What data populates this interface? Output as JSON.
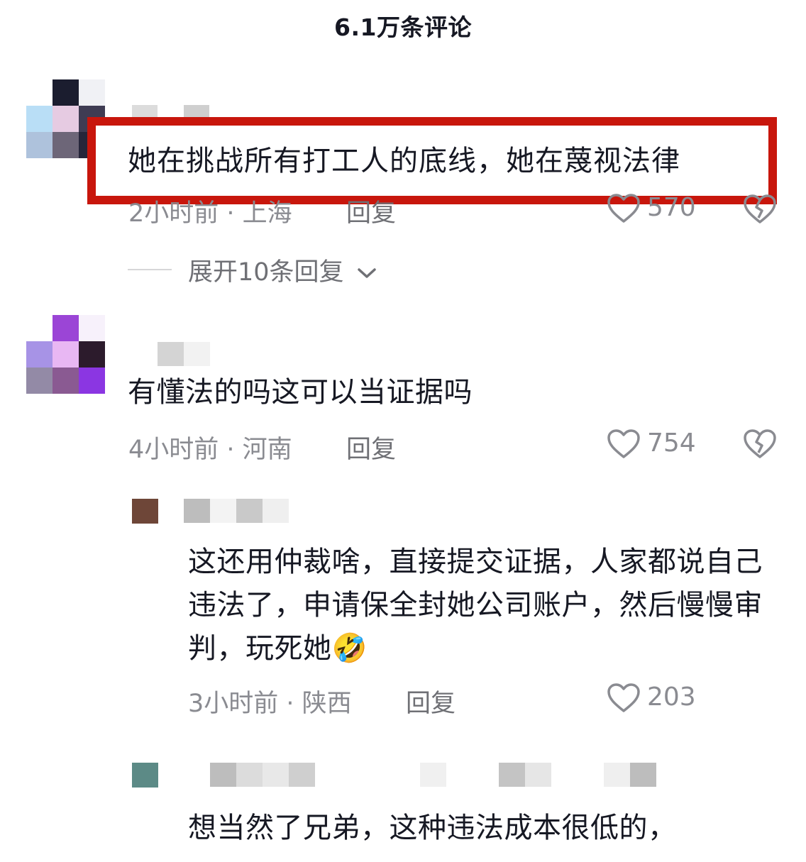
{
  "header": {
    "title": "6.1万条评论"
  },
  "comments": [
    {
      "text": "她在挑战所有打工人的底线，她在蔑视法律",
      "time": "2小时前",
      "location": "上海",
      "reply_label": "回复",
      "likes": "570",
      "expand_label": "展开10条回复"
    },
    {
      "text": "有懂法的吗这可以当证据吗",
      "time": "4小时前",
      "location": "河南",
      "reply_label": "回复",
      "likes": "754"
    }
  ],
  "replies": [
    {
      "text": "这还用仲裁啥，直接提交证据，人家都说自己违法了，申请保全封她公司账户，然后慢慢审判，玩死她",
      "emoji": "🤣",
      "time": "3小时前",
      "location": "陕西",
      "reply_label": "回复",
      "likes": "203"
    },
    {
      "text": "想当然了兄弟，这种违法成本很低的，"
    }
  ],
  "separator": " · ",
  "icons": {
    "like": "heart-outline-icon",
    "dislike": "broken-heart-icon",
    "expand": "chevron-down-icon"
  },
  "colors": {
    "highlight_border": "#c8160c",
    "meta_text": "#8a8b91",
    "body_text": "#161823"
  }
}
